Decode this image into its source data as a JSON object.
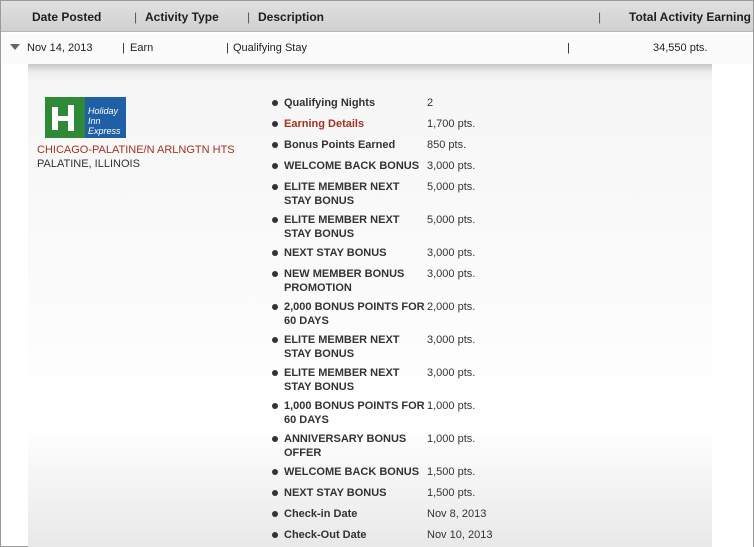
{
  "header": {
    "date_posted": "Date Posted",
    "activity_type": "Activity Type",
    "description": "Description",
    "total_earning": "Total Activity Earning"
  },
  "summary": {
    "date": "Nov 14, 2013",
    "type": "Earn",
    "description": "Qualifying Stay",
    "total": "34,550 pts."
  },
  "hotel": {
    "logo_text": "Holiday Inn Express",
    "name": "CHICAGO-PALATINE/N ARLNGTN HTS",
    "city": "PALATINE, ILLINOIS"
  },
  "details": [
    {
      "label": "Qualifying Nights",
      "value": "2"
    },
    {
      "label": "Earning Details",
      "value": "1,700 pts."
    },
    {
      "label": "Bonus Points Earned",
      "value": "850 pts."
    },
    {
      "label": "WELCOME BACK BONUS",
      "value": "3,000 pts."
    },
    {
      "label": "ELITE MEMBER NEXT STAY BONUS",
      "value": "5,000 pts."
    },
    {
      "label": "ELITE MEMBER NEXT STAY BONUS",
      "value": "5,000 pts."
    },
    {
      "label": "NEXT STAY BONUS",
      "value": "3,000 pts."
    },
    {
      "label": "NEW MEMBER BONUS PROMOTION",
      "value": "3,000 pts."
    },
    {
      "label": "2,000 BONUS POINTS FOR 60 DAYS",
      "value": "2,000 pts."
    },
    {
      "label": "ELITE MEMBER NEXT STAY BONUS",
      "value": "3,000 pts."
    },
    {
      "label": "ELITE MEMBER NEXT STAY BONUS",
      "value": "3,000 pts."
    },
    {
      "label": "1,000 BONUS POINTS FOR 60 DAYS",
      "value": "1,000 pts."
    },
    {
      "label": "ANNIVERSARY BONUS OFFER",
      "value": "1,000 pts."
    },
    {
      "label": "WELCOME BACK BONUS",
      "value": "1,500 pts."
    },
    {
      "label": "NEXT STAY BONUS",
      "value": "1,500 pts."
    },
    {
      "label": "Check-in Date",
      "value": "Nov 8, 2013"
    },
    {
      "label": "Check-Out Date",
      "value": "Nov 10, 2013"
    }
  ]
}
